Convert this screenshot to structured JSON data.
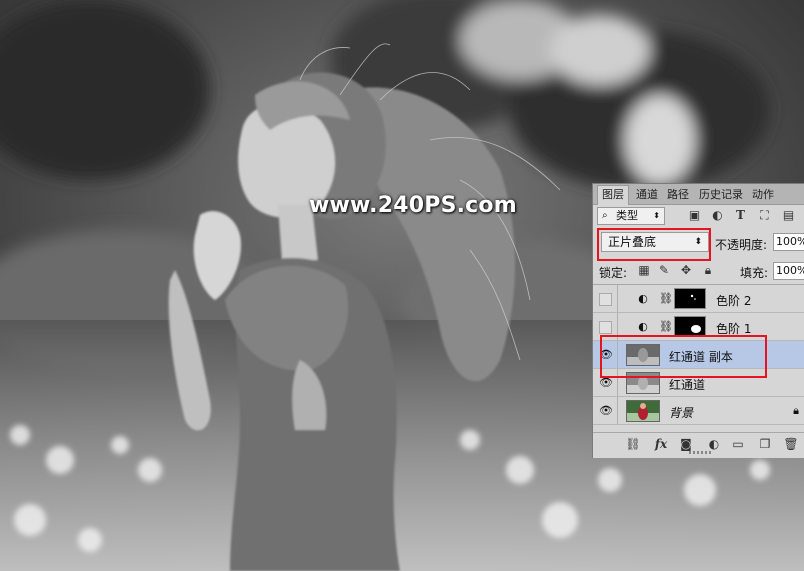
{
  "watermark": "www.240PS.com",
  "panel": {
    "tabs": [
      "图层",
      "通道",
      "路径",
      "历史记录",
      "动作"
    ],
    "kind_filter": {
      "icon": "search-icon",
      "label": "类型"
    },
    "filter_icons": [
      "image-filter-icon",
      "adjustment-filter-icon",
      "type-filter-icon",
      "shape-filter-icon",
      "smart-object-filter-icon"
    ],
    "blend_mode": "正片叠底",
    "opacity_label": "不透明度:",
    "opacity_value": "100%",
    "lock_label": "锁定:",
    "lock_icons": [
      "lock-transparent-icon",
      "lock-paint-icon",
      "lock-position-icon",
      "lock-all-icon"
    ],
    "fill_label": "填充:",
    "fill_value": "100%",
    "layers": [
      {
        "name": "色阶 2",
        "visible": false,
        "type": "adjustment",
        "selected": false
      },
      {
        "name": "色阶 1",
        "visible": false,
        "type": "adjustment",
        "selected": false
      },
      {
        "name": "红通道 副本",
        "visible": true,
        "type": "image",
        "selected": true
      },
      {
        "name": "红通道",
        "visible": true,
        "type": "image",
        "selected": false
      },
      {
        "name": "背景",
        "visible": true,
        "type": "image",
        "selected": false,
        "locked": true
      }
    ],
    "bottom_icons": [
      "link-layers-icon",
      "fx-icon",
      "add-mask-icon",
      "new-adjustment-icon",
      "new-group-icon",
      "new-layer-icon",
      "delete-layer-icon"
    ],
    "fx_label": "fx"
  },
  "colors": {
    "highlight": "#e6141e",
    "selection": "#b6c8e6"
  }
}
